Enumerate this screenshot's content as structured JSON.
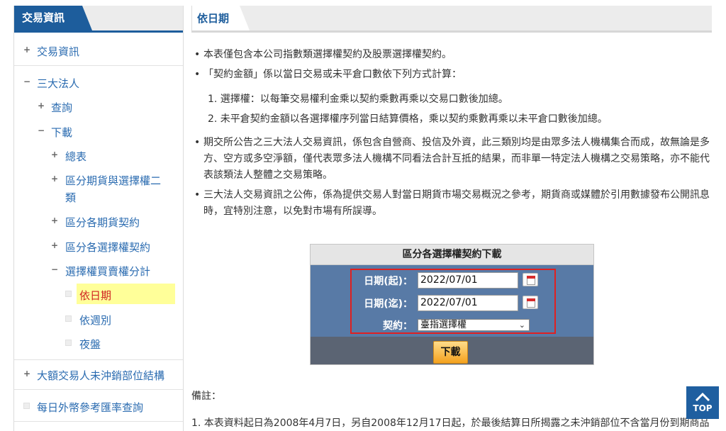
{
  "sidebar": {
    "tab_label": "交易資訊",
    "items": [
      {
        "label": "交易資訊",
        "control": "+"
      },
      {
        "label": "三大法人",
        "control": "−"
      },
      {
        "label": "查詢",
        "control": "+"
      },
      {
        "label": "下載",
        "control": "−"
      },
      {
        "label": "總表",
        "control": "+"
      },
      {
        "label": "區分期貨與選擇權二類",
        "line1": "區分期貨與選擇權二",
        "line2": "類",
        "control": "+"
      },
      {
        "label": "區分各期貨契約",
        "control": "+"
      },
      {
        "label": "區分各選擇權契約",
        "control": "+"
      },
      {
        "label": "選擇權買賣權分計",
        "control": "−"
      },
      {
        "label": "依日期",
        "control": "leaf",
        "selected": true
      },
      {
        "label": "依週別",
        "control": "leaf"
      },
      {
        "label": "夜盤",
        "control": "leaf"
      },
      {
        "label": "大額交易人未沖銷部位結構",
        "control": "+"
      },
      {
        "label": "每日外幣參考匯率查詢",
        "control": "leaf"
      }
    ]
  },
  "main": {
    "tab_label": "依日期",
    "bullets": [
      {
        "text": "本表僅包含本公司指數類選擇權契約及股票選擇權契約。"
      },
      {
        "text": "「契約金額」係以當日交易或未平倉口數依下列方式計算："
      },
      {
        "text": "期交所公告之三大法人交易資訊，係包含自營商、投信及外資，此三類別均是由眾多法人機構集合而成，故無論是多方、空方或多空淨額，僅代表眾多法人機構不同看法合計互抵的結果，而非單一特定法人機構之交易策略，亦不能代表該類法人整體之交易策略。",
        "lines": [
          "期交所公告之三大法人交易資訊，係包含自營商、投信及外資，此三類別均是由眾多法人機構集合而成，故無論是多",
          "方、空方或多空淨額，僅代表眾多法人機構不同看法合計互抵的結果，而非單一特定法人機構之交易策略，亦不能代",
          "表該類法人整體之交易策略。"
        ]
      },
      {
        "text": "三大法人交易資訊之公佈，係為提供交易人對當日期貨市場交易概況之參考，期貨商或媒體於引用數據發布公開訊息時，宜特別注意，以免對市場有所誤導。",
        "lines": [
          "三大法人交易資訊之公佈，係為提供交易人對當日期貨市場交易概況之參考，期貨商或媒體於引用數據發布公開訊息",
          "時，宜特別注意，以免對市場有所誤導。"
        ]
      }
    ],
    "numbered": [
      "1. 選擇權：以每筆交易權利金乘以契約乘數再乘以交易口數後加總。",
      "2. 未平倉契約金額以各選擇權序列當日結算價格，乘以契約乘數再乘以未平倉口數後加總。"
    ]
  },
  "form": {
    "title": "區分各選擇權契約下載",
    "start_label": "日期(起)：",
    "start_value": "2022/07/01",
    "end_label": "日期(迄)：",
    "end_value": "2022/07/01",
    "contract_label": "契約：",
    "contract_value": "臺指選擇權",
    "download_label": "下載"
  },
  "notes": {
    "title": "備註：",
    "line1": "1. 本表資料起日為2008年4月7日，另自2008年12月17日起，於最後結算日所揭露之未沖銷部位不含當月份到期商品"
  },
  "top_button": {
    "label": "TOP"
  },
  "colors": {
    "accent": "#1d5d9c",
    "highlight": "#ffff99",
    "form_body": "#587aa6",
    "alert_border": "#e02020"
  }
}
